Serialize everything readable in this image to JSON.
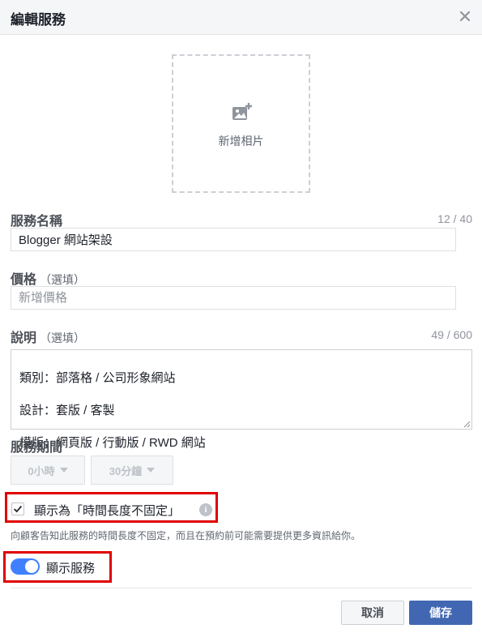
{
  "header": {
    "title": "編輯服務"
  },
  "photo": {
    "label": "新增相片"
  },
  "service_name": {
    "label": "服務名稱",
    "counter": "12 / 40",
    "value": "Blogger 網站架設"
  },
  "price": {
    "label": "價格",
    "optional": "（選填）",
    "placeholder": "新增價格",
    "value": ""
  },
  "description": {
    "label": "說明",
    "optional": "（選填）",
    "counter": "49 / 600",
    "lines": [
      "類別：部落格 / 公司形象網站",
      "設計：套版 / 客製",
      "模版：網頁版 / 行動版 / RWD 網站"
    ]
  },
  "duration": {
    "label": "服務期間",
    "hours": "0小時",
    "minutes": "30分鐘"
  },
  "variable_time": {
    "checked": true,
    "label": "顯示為「時間長度不固定」",
    "helper": "向顧客告知此服務的時間長度不固定，而且在預約前可能需要提供更多資訊給你。"
  },
  "show_service": {
    "on": true,
    "label": "顯示服務"
  },
  "footer": {
    "cancel": "取消",
    "save": "儲存"
  },
  "colors": {
    "accent": "#4267b2",
    "toggle": "#4080ff",
    "highlight": "#e00000"
  }
}
